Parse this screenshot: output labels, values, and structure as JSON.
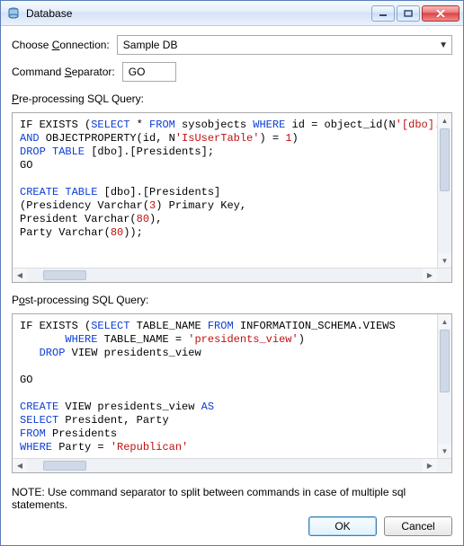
{
  "window": {
    "title": "Database"
  },
  "labels": {
    "choose_connection_pre": "Choose ",
    "choose_connection_u": "C",
    "choose_connection_post": "onnection:",
    "command_sep_pre": "Command ",
    "command_sep_u": "S",
    "command_sep_post": "eparator:",
    "pre_query_u": "P",
    "pre_query_post": "re-processing SQL Query:",
    "post_query_pre": "P",
    "post_query_u": "o",
    "post_query_post": "st-processing SQL Query:",
    "note": "NOTE: Use command separator to split between commands in case of multiple sql statements."
  },
  "connection": {
    "value": "Sample DB"
  },
  "separator": {
    "value": "GO"
  },
  "buttons": {
    "ok": "OK",
    "cancel": "Cancel"
  },
  "sql_pre": {
    "l1a": "IF EXISTS (",
    "l1kw1": "SELECT",
    "l1b": " * ",
    "l1kw2": "FROM",
    "l1c": " sysobjects ",
    "l1kw3": "WHERE",
    "l1d": " id = object_id(N",
    "l1s": "'[dbo].",
    "l1e": "",
    "l2kw": "AND",
    "l2a": " OBJECTPROPERTY(id, N",
    "l2s": "'IsUserTable'",
    "l2b": ") = ",
    "l2n": "1",
    "l2c": ")",
    "l3kw": "DROP TABLE",
    "l3a": " [dbo].[Presidents];",
    "l4": "GO",
    "l6kw": "CREATE TABLE",
    "l6a": " [dbo].[Presidents]",
    "l7a": "(Presidency Varchar(",
    "l7n": "3",
    "l7b": ") Primary Key,",
    "l8a": "President Varchar(",
    "l8n": "80",
    "l8b": "),",
    "l9a": "Party Varchar(",
    "l9n": "80",
    "l9b": "));"
  },
  "sql_post": {
    "l1a": "IF EXISTS (",
    "l1kw1": "SELECT",
    "l1b": " TABLE_NAME ",
    "l1kw2": "FROM",
    "l1c": " INFORMATION_SCHEMA.VIEWS",
    "l2a": "       ",
    "l2kw": "WHERE",
    "l2b": " TABLE_NAME = ",
    "l2s": "'presidents_view'",
    "l2c": ")",
    "l3a": "   ",
    "l3kw": "DROP",
    "l3b": " VIEW presidents_view",
    "l5": "GO",
    "l7kw": "CREATE",
    "l7a": " VIEW presidents_view ",
    "l7kw2": "AS",
    "l8kw": "SELECT",
    "l8a": " President, Party",
    "l9kw": "FROM",
    "l9a": " Presidents",
    "l10kw": "WHERE",
    "l10a": " Party = ",
    "l10s": "'Republican'"
  }
}
